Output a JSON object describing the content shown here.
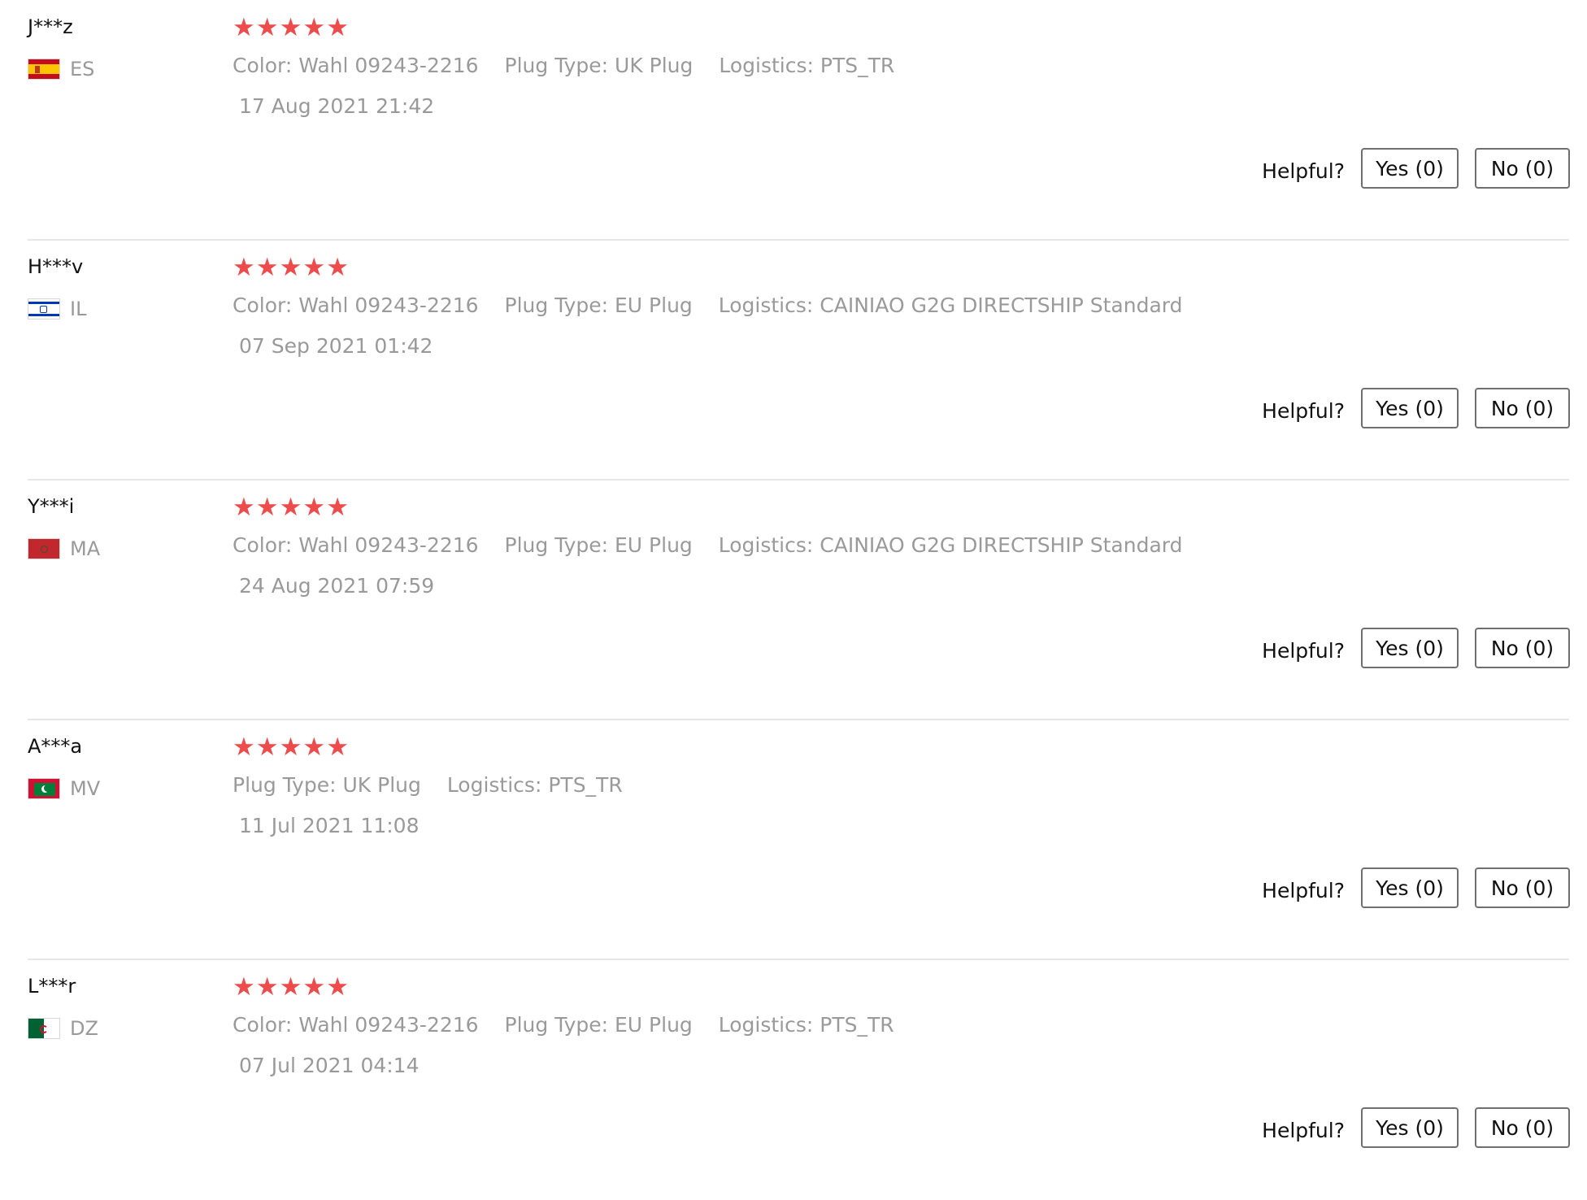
{
  "rating_star": "★",
  "helpful_label": "Helpful?",
  "colors": {
    "star": "#ee4c4c",
    "muted_text": "#999999",
    "divider": "#e6e6e6"
  },
  "reviews": [
    {
      "name": "J***z",
      "country": "ES",
      "flag_icon": "spain-flag-icon",
      "rating": 5,
      "attributes": [
        {
          "label": "Color:",
          "value": "Wahl 09243-2216"
        },
        {
          "label": "Plug Type:",
          "value": "UK Plug"
        },
        {
          "label": "Logistics:",
          "value": "PTS_TR"
        }
      ],
      "date": "17 Aug 2021 21:42",
      "yes": "Yes (0)",
      "no": "No (0)"
    },
    {
      "name": "H***v",
      "country": "IL",
      "flag_icon": "israel-flag-icon",
      "rating": 5,
      "attributes": [
        {
          "label": "Color:",
          "value": "Wahl 09243-2216"
        },
        {
          "label": "Plug Type:",
          "value": "EU Plug"
        },
        {
          "label": "Logistics:",
          "value": "CAINIAO G2G DIRECTSHIP Standard"
        }
      ],
      "date": "07 Sep 2021 01:42",
      "yes": "Yes (0)",
      "no": "No (0)"
    },
    {
      "name": "Y***i",
      "country": "MA",
      "flag_icon": "morocco-flag-icon",
      "rating": 5,
      "attributes": [
        {
          "label": "Color:",
          "value": "Wahl 09243-2216"
        },
        {
          "label": "Plug Type:",
          "value": "EU Plug"
        },
        {
          "label": "Logistics:",
          "value": "CAINIAO G2G DIRECTSHIP Standard"
        }
      ],
      "date": "24 Aug 2021 07:59",
      "yes": "Yes (0)",
      "no": "No (0)"
    },
    {
      "name": "A***a",
      "country": "MV",
      "flag_icon": "maldives-flag-icon",
      "rating": 5,
      "attributes": [
        {
          "label": "Plug Type:",
          "value": "UK Plug"
        },
        {
          "label": "Logistics:",
          "value": "PTS_TR"
        }
      ],
      "date": "11 Jul 2021 11:08",
      "yes": "Yes (0)",
      "no": "No (0)"
    },
    {
      "name": "L***r",
      "country": "DZ",
      "flag_icon": "algeria-flag-icon",
      "rating": 5,
      "attributes": [
        {
          "label": "Color:",
          "value": "Wahl 09243-2216"
        },
        {
          "label": "Plug Type:",
          "value": "EU Plug"
        },
        {
          "label": "Logistics:",
          "value": "PTS_TR"
        }
      ],
      "date": "07 Jul 2021 04:14",
      "yes": "Yes (0)",
      "no": "No (0)"
    }
  ]
}
